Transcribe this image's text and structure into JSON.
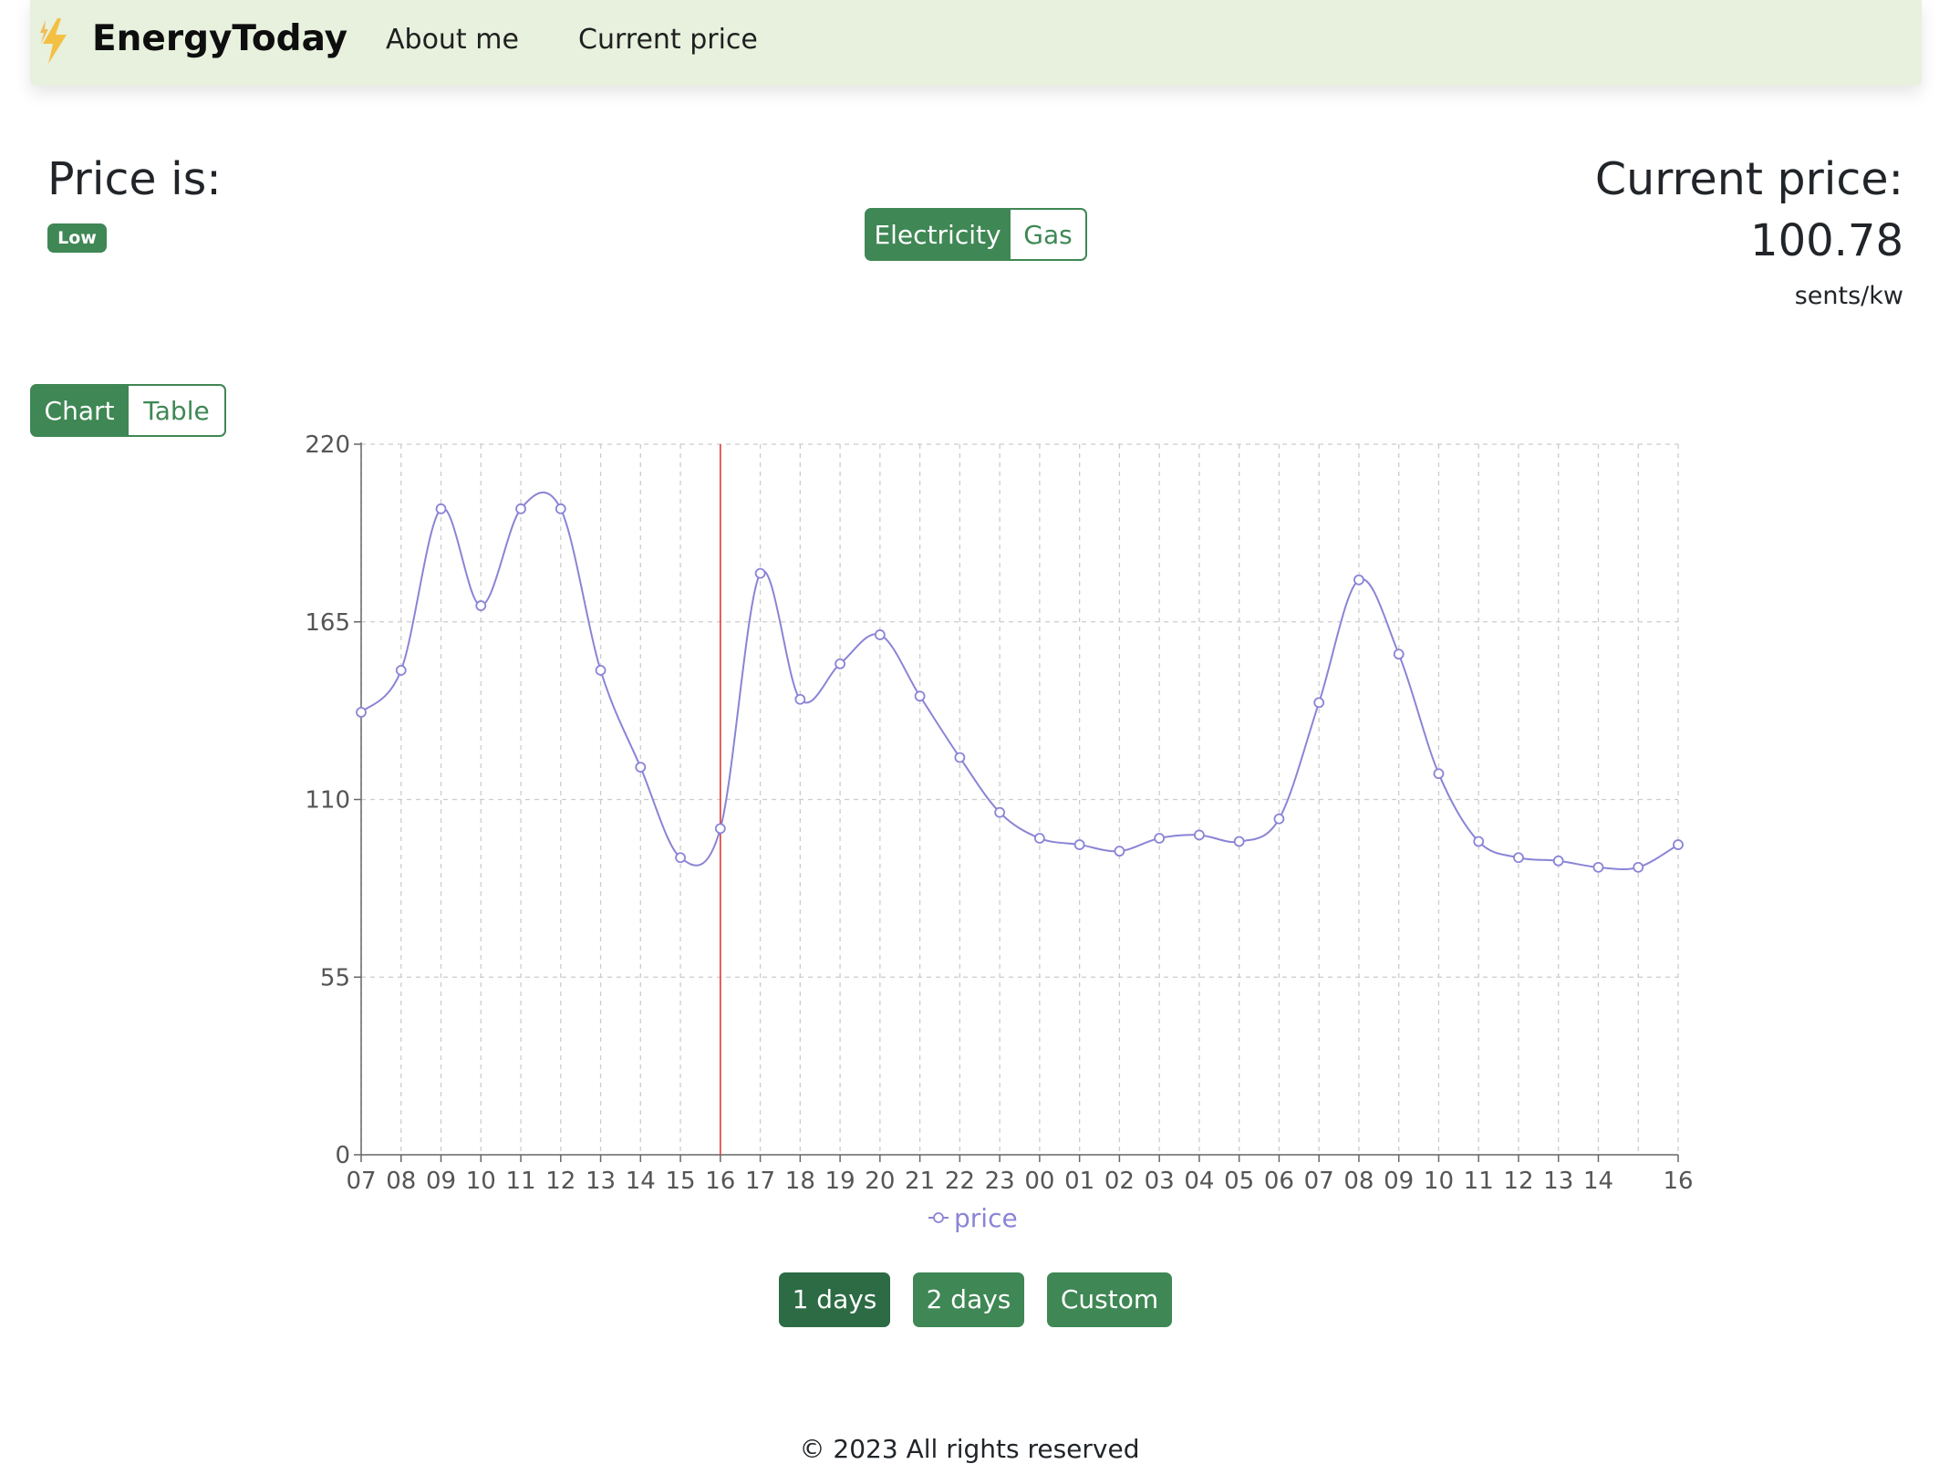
{
  "nav": {
    "brand": "EnergyToday",
    "links": [
      "About me",
      "Current price"
    ]
  },
  "status": {
    "title": "Price is:",
    "badge": "Low"
  },
  "energy_toggle": {
    "options": [
      "Electricity",
      "Gas"
    ],
    "selected": "Electricity"
  },
  "current": {
    "title": "Current price:",
    "value": "100.78",
    "unit": "sents/kw"
  },
  "view_toggle": {
    "options": [
      "Chart",
      "Table"
    ],
    "selected": "Chart"
  },
  "range_buttons": {
    "options": [
      "1 days",
      "2 days",
      "Custom"
    ],
    "selected": "1 days"
  },
  "footer": "© 2023 All rights reserved",
  "colors": {
    "accent": "#3f8754",
    "navbar_bg": "#e7f1de",
    "series": "#8a84d6",
    "current_marker": "#e03c31"
  },
  "chart_data": {
    "type": "line",
    "ylim": [
      0,
      220
    ],
    "yticks": [
      0,
      55,
      110,
      165,
      220
    ],
    "grid": true,
    "legend": "bottom-center",
    "x_tick_labels": [
      "07",
      "08",
      "09",
      "10",
      "11",
      "12",
      "13",
      "14",
      "15",
      "16",
      "17",
      "18",
      "19",
      "20",
      "21",
      "22",
      "23",
      "00",
      "01",
      "02",
      "03",
      "04",
      "05",
      "06",
      "07",
      "08",
      "09",
      "10",
      "11",
      "12",
      "13",
      "14",
      "16"
    ],
    "x_tick_positions": [
      0,
      1,
      2,
      3,
      4,
      5,
      6,
      7,
      8,
      9,
      10,
      11,
      12,
      13,
      14,
      15,
      16,
      17,
      18,
      19,
      20,
      21,
      22,
      23,
      24,
      25,
      26,
      27,
      28,
      29,
      30,
      31,
      33
    ],
    "current_hour_index": 9,
    "series": [
      {
        "name": "price",
        "values": [
          137,
          150,
          200,
          170,
          200,
          200,
          150,
          120,
          92,
          101,
          180,
          141,
          152,
          161,
          142,
          123,
          106,
          98,
          96,
          94,
          98,
          99,
          97,
          104,
          140,
          178,
          155,
          118,
          97,
          92,
          91,
          89,
          89,
          96
        ]
      }
    ]
  }
}
